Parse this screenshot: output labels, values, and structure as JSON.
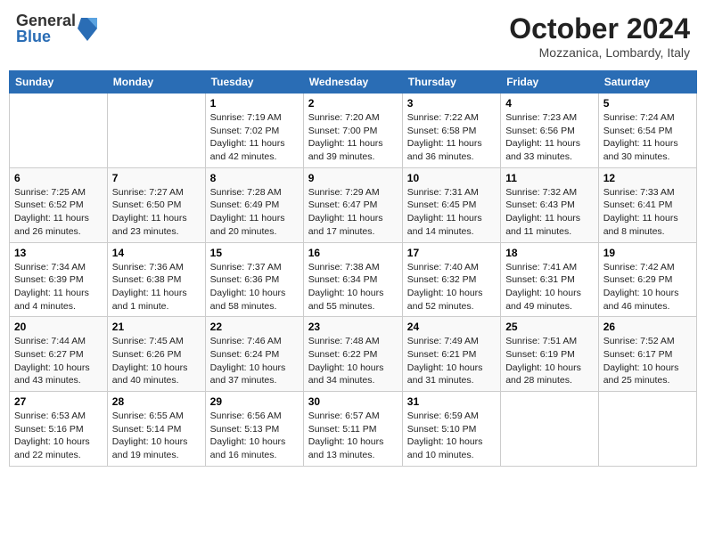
{
  "header": {
    "logo": {
      "general": "General",
      "blue": "Blue"
    },
    "title": "October 2024",
    "location": "Mozzanica, Lombardy, Italy"
  },
  "calendar": {
    "headers": [
      "Sunday",
      "Monday",
      "Tuesday",
      "Wednesday",
      "Thursday",
      "Friday",
      "Saturday"
    ],
    "weeks": [
      [
        {
          "day": "",
          "info": ""
        },
        {
          "day": "",
          "info": ""
        },
        {
          "day": "1",
          "info": "Sunrise: 7:19 AM\nSunset: 7:02 PM\nDaylight: 11 hours and 42 minutes."
        },
        {
          "day": "2",
          "info": "Sunrise: 7:20 AM\nSunset: 7:00 PM\nDaylight: 11 hours and 39 minutes."
        },
        {
          "day": "3",
          "info": "Sunrise: 7:22 AM\nSunset: 6:58 PM\nDaylight: 11 hours and 36 minutes."
        },
        {
          "day": "4",
          "info": "Sunrise: 7:23 AM\nSunset: 6:56 PM\nDaylight: 11 hours and 33 minutes."
        },
        {
          "day": "5",
          "info": "Sunrise: 7:24 AM\nSunset: 6:54 PM\nDaylight: 11 hours and 30 minutes."
        }
      ],
      [
        {
          "day": "6",
          "info": "Sunrise: 7:25 AM\nSunset: 6:52 PM\nDaylight: 11 hours and 26 minutes."
        },
        {
          "day": "7",
          "info": "Sunrise: 7:27 AM\nSunset: 6:50 PM\nDaylight: 11 hours and 23 minutes."
        },
        {
          "day": "8",
          "info": "Sunrise: 7:28 AM\nSunset: 6:49 PM\nDaylight: 11 hours and 20 minutes."
        },
        {
          "day": "9",
          "info": "Sunrise: 7:29 AM\nSunset: 6:47 PM\nDaylight: 11 hours and 17 minutes."
        },
        {
          "day": "10",
          "info": "Sunrise: 7:31 AM\nSunset: 6:45 PM\nDaylight: 11 hours and 14 minutes."
        },
        {
          "day": "11",
          "info": "Sunrise: 7:32 AM\nSunset: 6:43 PM\nDaylight: 11 hours and 11 minutes."
        },
        {
          "day": "12",
          "info": "Sunrise: 7:33 AM\nSunset: 6:41 PM\nDaylight: 11 hours and 8 minutes."
        }
      ],
      [
        {
          "day": "13",
          "info": "Sunrise: 7:34 AM\nSunset: 6:39 PM\nDaylight: 11 hours and 4 minutes."
        },
        {
          "day": "14",
          "info": "Sunrise: 7:36 AM\nSunset: 6:38 PM\nDaylight: 11 hours and 1 minute."
        },
        {
          "day": "15",
          "info": "Sunrise: 7:37 AM\nSunset: 6:36 PM\nDaylight: 10 hours and 58 minutes."
        },
        {
          "day": "16",
          "info": "Sunrise: 7:38 AM\nSunset: 6:34 PM\nDaylight: 10 hours and 55 minutes."
        },
        {
          "day": "17",
          "info": "Sunrise: 7:40 AM\nSunset: 6:32 PM\nDaylight: 10 hours and 52 minutes."
        },
        {
          "day": "18",
          "info": "Sunrise: 7:41 AM\nSunset: 6:31 PM\nDaylight: 10 hours and 49 minutes."
        },
        {
          "day": "19",
          "info": "Sunrise: 7:42 AM\nSunset: 6:29 PM\nDaylight: 10 hours and 46 minutes."
        }
      ],
      [
        {
          "day": "20",
          "info": "Sunrise: 7:44 AM\nSunset: 6:27 PM\nDaylight: 10 hours and 43 minutes."
        },
        {
          "day": "21",
          "info": "Sunrise: 7:45 AM\nSunset: 6:26 PM\nDaylight: 10 hours and 40 minutes."
        },
        {
          "day": "22",
          "info": "Sunrise: 7:46 AM\nSunset: 6:24 PM\nDaylight: 10 hours and 37 minutes."
        },
        {
          "day": "23",
          "info": "Sunrise: 7:48 AM\nSunset: 6:22 PM\nDaylight: 10 hours and 34 minutes."
        },
        {
          "day": "24",
          "info": "Sunrise: 7:49 AM\nSunset: 6:21 PM\nDaylight: 10 hours and 31 minutes."
        },
        {
          "day": "25",
          "info": "Sunrise: 7:51 AM\nSunset: 6:19 PM\nDaylight: 10 hours and 28 minutes."
        },
        {
          "day": "26",
          "info": "Sunrise: 7:52 AM\nSunset: 6:17 PM\nDaylight: 10 hours and 25 minutes."
        }
      ],
      [
        {
          "day": "27",
          "info": "Sunrise: 6:53 AM\nSunset: 5:16 PM\nDaylight: 10 hours and 22 minutes."
        },
        {
          "day": "28",
          "info": "Sunrise: 6:55 AM\nSunset: 5:14 PM\nDaylight: 10 hours and 19 minutes."
        },
        {
          "day": "29",
          "info": "Sunrise: 6:56 AM\nSunset: 5:13 PM\nDaylight: 10 hours and 16 minutes."
        },
        {
          "day": "30",
          "info": "Sunrise: 6:57 AM\nSunset: 5:11 PM\nDaylight: 10 hours and 13 minutes."
        },
        {
          "day": "31",
          "info": "Sunrise: 6:59 AM\nSunset: 5:10 PM\nDaylight: 10 hours and 10 minutes."
        },
        {
          "day": "",
          "info": ""
        },
        {
          "day": "",
          "info": ""
        }
      ]
    ]
  }
}
